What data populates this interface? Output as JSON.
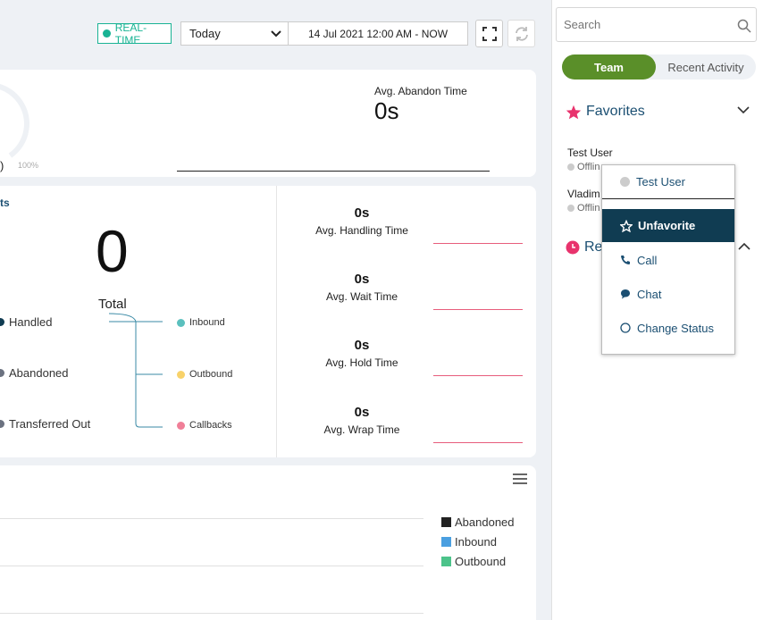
{
  "toolbar": {
    "realtime_label": "REAL-TIME",
    "date_option": "Today",
    "date_range": "14 Jul 2021 12:00 AM - NOW"
  },
  "gauge": {
    "paren": ")",
    "max_label": "100%"
  },
  "abandon": {
    "label": "Avg. Abandon Time",
    "value": "0s"
  },
  "calls": {
    "section_label": "ts",
    "total_value": "0",
    "total_label": "Total",
    "left_legend": [
      "Handled",
      "Abandoned",
      "Transferred Out"
    ],
    "right_legend": [
      "Inbound",
      "Outbound",
      "Callbacks"
    ]
  },
  "metrics": [
    {
      "value": "0s",
      "label": "Avg. Handling Time"
    },
    {
      "value": "0s",
      "label": "Avg. Wait Time"
    },
    {
      "value": "0s",
      "label": "Avg. Hold Time"
    },
    {
      "value": "0s",
      "label": "Avg. Wrap Time"
    }
  ],
  "chart": {
    "legend": [
      {
        "name": "Abandoned",
        "color": "#222222"
      },
      {
        "name": "Inbound",
        "color": "#4a9fe0"
      },
      {
        "name": "Outbound",
        "color": "#4cc38a"
      }
    ]
  },
  "panel": {
    "search_placeholder": "Search",
    "tab_team": "Team",
    "tab_recent": "Recent Activity",
    "favorites_title": "Favorites",
    "users": [
      {
        "name": "Test User",
        "status": "Offlin"
      },
      {
        "name": "Vladim",
        "status": "Offlin"
      }
    ],
    "recent_title": "Rec"
  },
  "context_menu": {
    "user": "Test User",
    "unfavorite": "Unfavorite",
    "call": "Call",
    "chat": "Chat",
    "change_status": "Change Status"
  },
  "colors": {
    "realtime": "#19b394",
    "team_tab": "#5a8f29",
    "favorite_star": "#e8336d",
    "menu_highlight": "#103c52",
    "handled": "#103c52",
    "abandoned": "#6b7280",
    "inbound": "#5bc0be",
    "outbound": "#f8d26a",
    "callbacks": "#f07f98"
  }
}
